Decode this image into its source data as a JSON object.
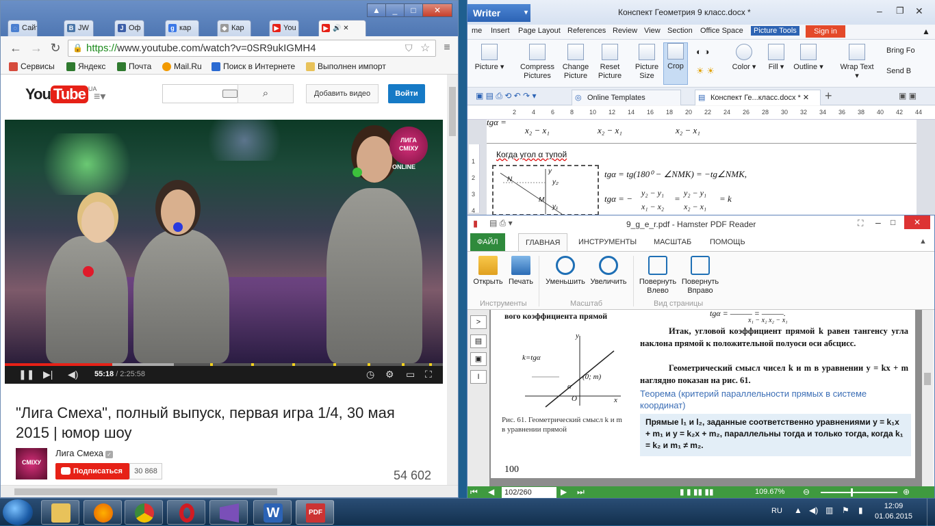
{
  "browser": {
    "tabs": [
      {
        "label": "Сайт",
        "icon": "loading-icon",
        "color": "#4a7fd0"
      },
      {
        "label": "JW",
        "icon": "vk-icon",
        "color": "#4a76a8"
      },
      {
        "label": "Оф",
        "icon": "jw-icon",
        "color": "#3d5fa8"
      },
      {
        "label": "кар",
        "icon": "google-icon",
        "color": "#3b78e7"
      },
      {
        "label": "Кар",
        "icon": "map-icon",
        "color": "#9a9a9a"
      },
      {
        "label": "You",
        "icon": "youtube-icon",
        "color": "#e62117"
      },
      {
        "label": "",
        "icon": "youtube-icon",
        "color": "#e62117"
      }
    ],
    "url_scheme": "https://",
    "url_host": "www.youtube.com",
    "url_path": "/watch?v=0SR9ukIGMH4",
    "bookmarks": [
      {
        "label": "Сервисы",
        "icon": "apps-icon",
        "color": "#d64b3c"
      },
      {
        "label": "Яндекс",
        "icon": "yandex-icon",
        "color": "#2f7a2f"
      },
      {
        "label": "Почта",
        "icon": "mail-icon",
        "color": "#2f7a2f"
      },
      {
        "label": "Mail.Ru",
        "icon": "mailru-icon",
        "color": "#f29a00"
      },
      {
        "label": "Поиск в Интернете",
        "icon": "search-icon",
        "color": "#2a6ad2"
      },
      {
        "label": "Выполнен импорт",
        "icon": "folder-icon",
        "color": "#e8c25a"
      }
    ]
  },
  "youtube": {
    "logo_you": "You",
    "logo_tube": "Tube",
    "logo_region": "UA",
    "upload_label": "Добавить видео",
    "signin_label": "Войти",
    "player": {
      "brand_top": "ЛИГА",
      "brand_bottom": "СМІХУ",
      "brand_online": "ONLINE",
      "time_current": "55:18",
      "time_total": " / 2:25:58",
      "progress": 0.246
    },
    "title": "\"Лига Смеха\", полный выпуск, первая игра 1/4, 30 мая 2015 | юмор шоу",
    "channel_name": "Лига Смеха",
    "subscribe_label": "Подписаться",
    "subscriber_count": "30 868",
    "views": "54 602"
  },
  "writer": {
    "app_label": "Writer",
    "doc_title": "Конспект Геометрия 9 класс.docx *",
    "menu": [
      "Home",
      "Insert",
      "Page Layout",
      "References",
      "Review",
      "View",
      "Section",
      "Office Space",
      "Picture Tools"
    ],
    "menu_visible_first": "me",
    "signin_label": "Sign in",
    "ribbon": [
      {
        "label": "Picture",
        "sub": ""
      },
      {
        "label": "Compress",
        "sub": "Pictures"
      },
      {
        "label": "Change",
        "sub": "Picture"
      },
      {
        "label": "Reset",
        "sub": "Picture"
      },
      {
        "label": "Picture",
        "sub": "Size"
      },
      {
        "label": "Crop",
        "sub": ""
      },
      {
        "label": "Color",
        "sub": ""
      },
      {
        "label": "Fill",
        "sub": ""
      },
      {
        "label": "Outline",
        "sub": ""
      },
      {
        "label": "Wrap Text",
        "sub": ""
      },
      {
        "label": "Bring Fo",
        "sub": "Send B"
      }
    ],
    "doc_tabs": [
      "Online Templates",
      "Конспект Ге...класс.docx *"
    ],
    "ruler_ticks": [
      "2",
      "4",
      "6",
      "8",
      "10",
      "12",
      "14",
      "16",
      "18",
      "20",
      "22",
      "24",
      "26",
      "28",
      "30",
      "32",
      "34",
      "36",
      "38",
      "40",
      "42",
      "44"
    ],
    "vruler_ticks": [
      "1",
      "2",
      "3",
      "4"
    ],
    "text_obtuse": "Когда угол α тупой",
    "formula_1": "tgα = tg(180⁰ − ∠NMK) = −tg∠NMK,",
    "formula_2a": "tgα = −",
    "formula_2b": "y₂ − y₁",
    "formula_2c": "x₁ − x₂",
    "formula_2d": "=",
    "formula_2e": "y₂ − y₁",
    "formula_2f": "x₂ − x₁",
    "formula_2g": "= k",
    "formula_top_a": "tgα =",
    "formula_top_b": "x₂ − x₁",
    "formula_top_c": "x₂ − x₁",
    "formula_top_d": "x₂ − x₁",
    "graph_labels": {
      "n": "N",
      "y": "y",
      "y2": "y₂",
      "m": "M",
      "y1": "y₁"
    }
  },
  "pdf": {
    "title": "9_g_e_r.pdf - Hamster PDF Reader",
    "menu": [
      "ФАЙЛ",
      "ГЛАВНАЯ",
      "ИНСТРУМЕНТЫ",
      "МАСШТАБ",
      "ПОМОЩЬ"
    ],
    "ribbon": [
      {
        "label": "Открыть",
        "sub": ""
      },
      {
        "label": "Печать",
        "sub": ""
      },
      {
        "label": "Уменьшить",
        "sub": ""
      },
      {
        "label": "Увеличить",
        "sub": ""
      },
      {
        "label": "Повернуть",
        "sub": "Влево"
      },
      {
        "label": "Повернуть",
        "sub": "Вправо"
      }
    ],
    "groups": [
      "Инструменты",
      "Масштаб",
      "Вид страницы"
    ],
    "page": {
      "top_left": "вого коэффициента прямой",
      "top_formula": "tgα = ——— = ———.",
      "top_formula_den": "x₁ − x₂        x₂ − x₁",
      "p1": "Итак, угловой коэффициент прямой k равен тангенсу угла наклона прямой к положительной полуоси оси абсцисс.",
      "p2": "Геометрический смысл чисел k и m в уравнении y = kx + m наглядно показан на рис. 61.",
      "theorem": "Теорема (критерий параллельности прямых в системе координат)",
      "theorem_body": "Прямые l₁ и l₂, заданные соответственно уравнениями y = k₁x + m₁ и y = k₂x + m₂, параллельны тогда и только тогда, когда  k₁ = k₂ и m₁ ≠ m₂.",
      "fig_k": "k=tgα",
      "fig_y": "y",
      "fig_alpha": "α",
      "fig_point": "(0; m)",
      "fig_o": "O",
      "fig_x": "x",
      "caption": "Рис. 61. Геометрический смысл k и m в уравнении прямой",
      "page_num": "100"
    },
    "page_input": "102/260",
    "zoom": "109.67%"
  },
  "taskbar": {
    "apps": [
      {
        "name": "explorer",
        "color": "#e8c25a"
      },
      {
        "name": "firefox",
        "color": "#e66000"
      },
      {
        "name": "chrome",
        "color": "#3b8a3b"
      },
      {
        "name": "opera",
        "color": "#d01b23"
      },
      {
        "name": "vs",
        "color": "#7a4fb8"
      },
      {
        "name": "wps-writer",
        "color": "#2c63b5"
      },
      {
        "name": "pdf",
        "color": "#c33"
      }
    ],
    "lang": "RU",
    "time": "12:09",
    "date": "01.06.2015"
  }
}
